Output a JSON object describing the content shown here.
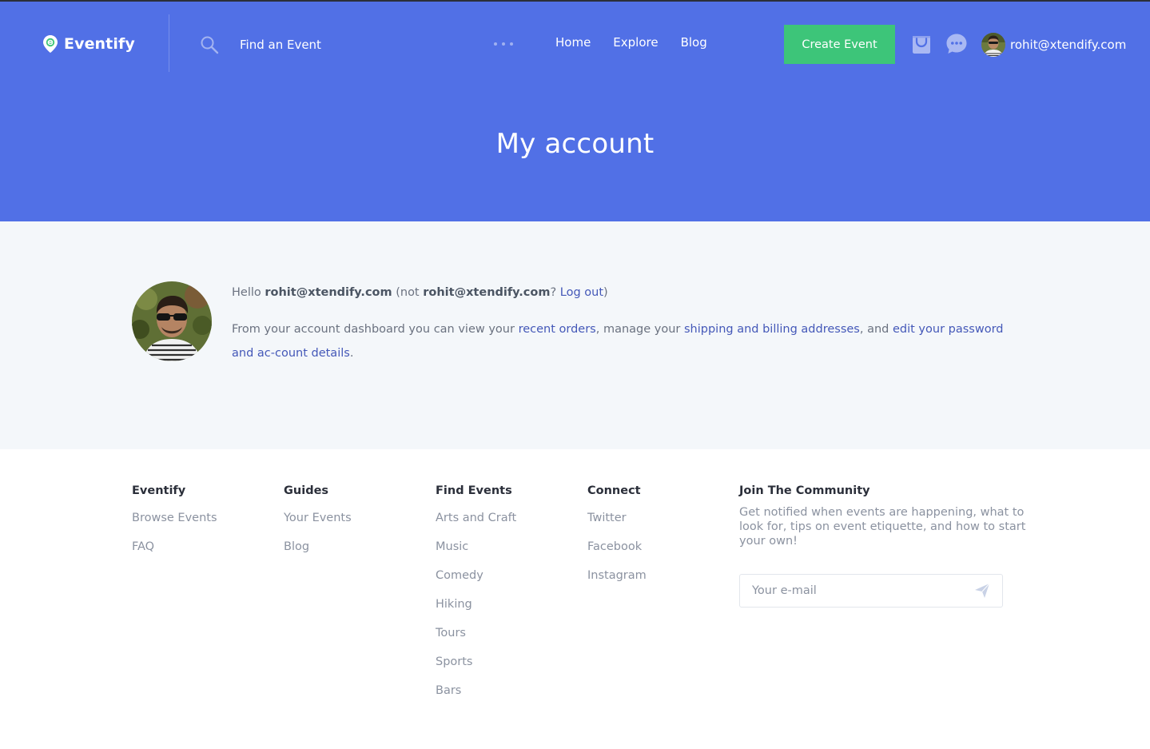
{
  "brand": {
    "name": "Eventify",
    "accent": "#5170e6",
    "green": "#3dc579"
  },
  "header": {
    "search_placeholder": "Find an Event",
    "nav": [
      "Home",
      "Explore",
      "Blog"
    ],
    "create_button": "Create Event",
    "user_email": "rohit@xtendify.com",
    "icons": [
      "search-icon",
      "more-dots-icon",
      "cart-icon",
      "chat-icon",
      "user-avatar"
    ]
  },
  "page": {
    "title": "My account"
  },
  "account": {
    "hello": "Hello",
    "user": "rohit@xtendify.com",
    "not_open": "(not",
    "user2": "rohit@xtendify.com",
    "qmark": "?",
    "logout": "Log out",
    "close": ")",
    "dash_1": "From your account dashboard you can view your",
    "recent_orders": "recent orders",
    "dash_2": ", manage your",
    "addresses": "shipping and billing addresses",
    "dash_3": ", and",
    "password": "edit your password and ac-count details",
    "dash_4": "."
  },
  "footer": {
    "columns": [
      {
        "title": "Eventify",
        "items": [
          "Browse Events",
          "FAQ"
        ]
      },
      {
        "title": "Guides",
        "items": [
          "Your Events",
          "Blog"
        ]
      },
      {
        "title": "Find Events",
        "items": [
          "Arts and Craft",
          "Music",
          "Comedy",
          "Hiking",
          "Tours",
          "Sports",
          "Bars"
        ]
      },
      {
        "title": "Connect",
        "items": [
          "Twitter",
          "Facebook",
          "Instagram"
        ]
      }
    ],
    "community": {
      "title": "Join The Community",
      "text": "Get notified when events are happening, what to look for, tips on event etiquette, and how to start your own!",
      "email_placeholder": "Your e-mail"
    }
  }
}
